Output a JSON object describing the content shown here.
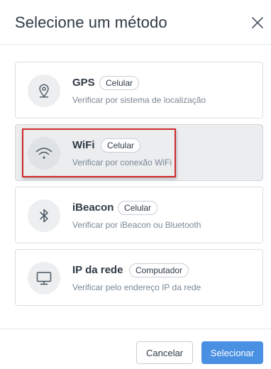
{
  "dialog": {
    "title": "Selecione um método",
    "close_icon": "close-icon"
  },
  "methods": [
    {
      "name": "GPS",
      "badge": "Celular",
      "description": "Verificar por sistema de localização",
      "icon": "location-pin-icon",
      "selected": false
    },
    {
      "name": "WiFi",
      "badge": "Celular",
      "description": "Verificar por conexão WiFi",
      "icon": "wifi-icon",
      "selected": true
    },
    {
      "name": "iBeacon",
      "badge": "Celular",
      "description": "Verificar por iBeacon ou Bluetooth",
      "icon": "bluetooth-icon",
      "selected": false
    },
    {
      "name": "IP da rede",
      "badge": "Computador",
      "description": "Verificar pelo endereço IP da rede",
      "icon": "monitor-icon",
      "selected": false
    }
  ],
  "footer": {
    "cancel_label": "Cancelar",
    "select_label": "Selecionar"
  },
  "colors": {
    "primary": "#4a90e2",
    "highlight_border": "#d0282b",
    "selected_background": "#ebedef"
  }
}
